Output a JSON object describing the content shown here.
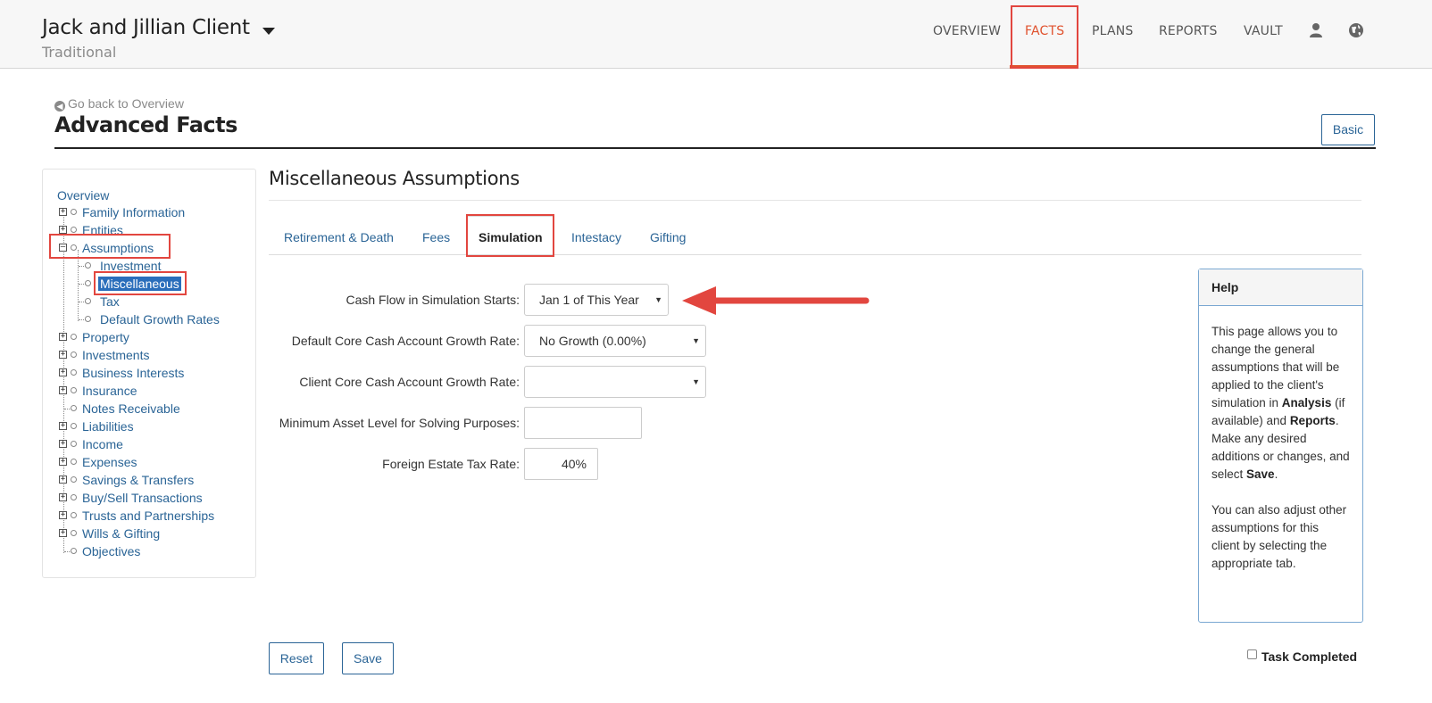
{
  "header": {
    "client_name": "Jack and Jillian Client",
    "client_subtitle": "Traditional",
    "nav": {
      "overview": "OVERVIEW",
      "facts": "FACTS",
      "plans": "PLANS",
      "reports": "REPORTS",
      "vault": "VAULT"
    },
    "active_nav": "FACTS",
    "accent_color": "#e0522e",
    "highlight_color": "#e2463f"
  },
  "page": {
    "back_link": "Go back to Overview",
    "title": "Advanced Facts",
    "basic_button": "Basic"
  },
  "tree": {
    "overview": "Overview",
    "family_information": "Family Information",
    "entities": "Entities",
    "assumptions": "Assumptions",
    "investment": "Investment",
    "miscellaneous": "Miscellaneous",
    "tax": "Tax",
    "default_growth_rates": "Default Growth Rates",
    "property": "Property",
    "investments": "Investments",
    "business_interests": "Business Interests",
    "insurance": "Insurance",
    "notes_receivable": "Notes Receivable",
    "liabilities": "Liabilities",
    "income": "Income",
    "expenses": "Expenses",
    "savings_transfers": "Savings & Transfers",
    "buy_sell": "Buy/Sell Transactions",
    "trusts": "Trusts and Partnerships",
    "wills": "Wills & Gifting",
    "objectives": "Objectives",
    "selected": "Miscellaneous"
  },
  "main": {
    "section_title": "Miscellaneous Assumptions",
    "tabs": {
      "retirement": "Retirement & Death",
      "fees": "Fees",
      "simulation": "Simulation",
      "intestacy": "Intestacy",
      "gifting": "Gifting"
    },
    "active_tab": "Simulation",
    "form": {
      "cash_flow_label": "Cash Flow in Simulation Starts:",
      "cash_flow_value": "Jan 1 of This Year",
      "default_growth_label": "Default Core Cash Account Growth Rate:",
      "default_growth_value": "No Growth (0.00%)",
      "client_growth_label": "Client Core Cash Account Growth Rate:",
      "client_growth_value": "",
      "min_asset_label": "Minimum Asset Level for Solving Purposes:",
      "min_asset_value": "",
      "foreign_tax_label": "Foreign Estate Tax Rate:",
      "foreign_tax_value": "40%"
    }
  },
  "help": {
    "title": "Help",
    "p1_a": "This page allows you to change the general assumptions that will be applied to the client's simulation in ",
    "p1_analysis": "Analysis",
    "p1_b": " (if available) and ",
    "p1_reports": "Reports",
    "p1_c": ". Make any desired additions or changes, and select ",
    "p1_save": "Save",
    "p1_d": ".",
    "p2": "You can also adjust other assumptions for this client by selecting the appropriate tab."
  },
  "footer": {
    "reset_button": "Reset",
    "save_button": "Save",
    "task_completed_label": "Task Completed",
    "task_completed_checked": false
  }
}
